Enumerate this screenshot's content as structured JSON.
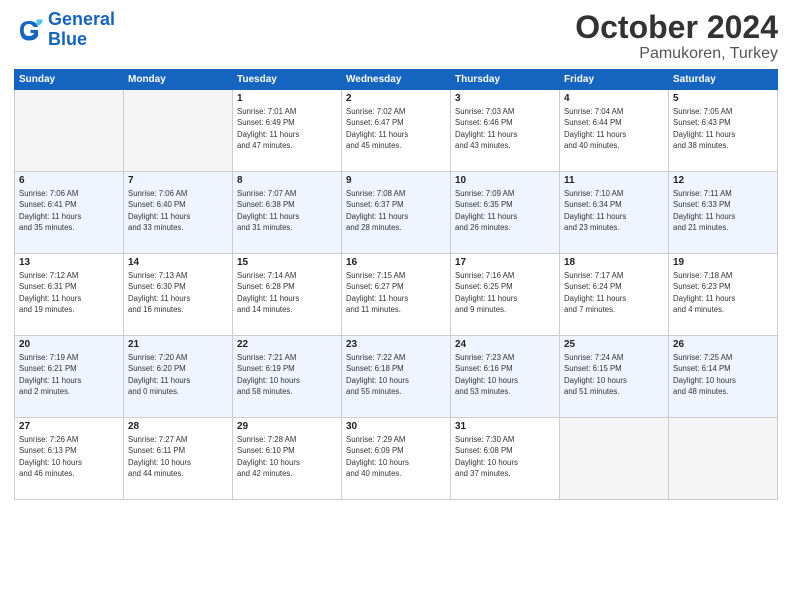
{
  "header": {
    "logo_line1": "General",
    "logo_line2": "Blue",
    "month": "October 2024",
    "location": "Pamukoren, Turkey"
  },
  "weekdays": [
    "Sunday",
    "Monday",
    "Tuesday",
    "Wednesday",
    "Thursday",
    "Friday",
    "Saturday"
  ],
  "weeks": [
    [
      {
        "day": "",
        "info": ""
      },
      {
        "day": "",
        "info": ""
      },
      {
        "day": "1",
        "info": "Sunrise: 7:01 AM\nSunset: 6:49 PM\nDaylight: 11 hours\nand 47 minutes."
      },
      {
        "day": "2",
        "info": "Sunrise: 7:02 AM\nSunset: 6:47 PM\nDaylight: 11 hours\nand 45 minutes."
      },
      {
        "day": "3",
        "info": "Sunrise: 7:03 AM\nSunset: 6:46 PM\nDaylight: 11 hours\nand 43 minutes."
      },
      {
        "day": "4",
        "info": "Sunrise: 7:04 AM\nSunset: 6:44 PM\nDaylight: 11 hours\nand 40 minutes."
      },
      {
        "day": "5",
        "info": "Sunrise: 7:05 AM\nSunset: 6:43 PM\nDaylight: 11 hours\nand 38 minutes."
      }
    ],
    [
      {
        "day": "6",
        "info": "Sunrise: 7:06 AM\nSunset: 6:41 PM\nDaylight: 11 hours\nand 35 minutes."
      },
      {
        "day": "7",
        "info": "Sunrise: 7:06 AM\nSunset: 6:40 PM\nDaylight: 11 hours\nand 33 minutes."
      },
      {
        "day": "8",
        "info": "Sunrise: 7:07 AM\nSunset: 6:38 PM\nDaylight: 11 hours\nand 31 minutes."
      },
      {
        "day": "9",
        "info": "Sunrise: 7:08 AM\nSunset: 6:37 PM\nDaylight: 11 hours\nand 28 minutes."
      },
      {
        "day": "10",
        "info": "Sunrise: 7:09 AM\nSunset: 6:35 PM\nDaylight: 11 hours\nand 26 minutes."
      },
      {
        "day": "11",
        "info": "Sunrise: 7:10 AM\nSunset: 6:34 PM\nDaylight: 11 hours\nand 23 minutes."
      },
      {
        "day": "12",
        "info": "Sunrise: 7:11 AM\nSunset: 6:33 PM\nDaylight: 11 hours\nand 21 minutes."
      }
    ],
    [
      {
        "day": "13",
        "info": "Sunrise: 7:12 AM\nSunset: 6:31 PM\nDaylight: 11 hours\nand 19 minutes."
      },
      {
        "day": "14",
        "info": "Sunrise: 7:13 AM\nSunset: 6:30 PM\nDaylight: 11 hours\nand 16 minutes."
      },
      {
        "day": "15",
        "info": "Sunrise: 7:14 AM\nSunset: 6:28 PM\nDaylight: 11 hours\nand 14 minutes."
      },
      {
        "day": "16",
        "info": "Sunrise: 7:15 AM\nSunset: 6:27 PM\nDaylight: 11 hours\nand 11 minutes."
      },
      {
        "day": "17",
        "info": "Sunrise: 7:16 AM\nSunset: 6:25 PM\nDaylight: 11 hours\nand 9 minutes."
      },
      {
        "day": "18",
        "info": "Sunrise: 7:17 AM\nSunset: 6:24 PM\nDaylight: 11 hours\nand 7 minutes."
      },
      {
        "day": "19",
        "info": "Sunrise: 7:18 AM\nSunset: 6:23 PM\nDaylight: 11 hours\nand 4 minutes."
      }
    ],
    [
      {
        "day": "20",
        "info": "Sunrise: 7:19 AM\nSunset: 6:21 PM\nDaylight: 11 hours\nand 2 minutes."
      },
      {
        "day": "21",
        "info": "Sunrise: 7:20 AM\nSunset: 6:20 PM\nDaylight: 11 hours\nand 0 minutes."
      },
      {
        "day": "22",
        "info": "Sunrise: 7:21 AM\nSunset: 6:19 PM\nDaylight: 10 hours\nand 58 minutes."
      },
      {
        "day": "23",
        "info": "Sunrise: 7:22 AM\nSunset: 6:18 PM\nDaylight: 10 hours\nand 55 minutes."
      },
      {
        "day": "24",
        "info": "Sunrise: 7:23 AM\nSunset: 6:16 PM\nDaylight: 10 hours\nand 53 minutes."
      },
      {
        "day": "25",
        "info": "Sunrise: 7:24 AM\nSunset: 6:15 PM\nDaylight: 10 hours\nand 51 minutes."
      },
      {
        "day": "26",
        "info": "Sunrise: 7:25 AM\nSunset: 6:14 PM\nDaylight: 10 hours\nand 48 minutes."
      }
    ],
    [
      {
        "day": "27",
        "info": "Sunrise: 7:26 AM\nSunset: 6:13 PM\nDaylight: 10 hours\nand 46 minutes."
      },
      {
        "day": "28",
        "info": "Sunrise: 7:27 AM\nSunset: 6:11 PM\nDaylight: 10 hours\nand 44 minutes."
      },
      {
        "day": "29",
        "info": "Sunrise: 7:28 AM\nSunset: 6:10 PM\nDaylight: 10 hours\nand 42 minutes."
      },
      {
        "day": "30",
        "info": "Sunrise: 7:29 AM\nSunset: 6:09 PM\nDaylight: 10 hours\nand 40 minutes."
      },
      {
        "day": "31",
        "info": "Sunrise: 7:30 AM\nSunset: 6:08 PM\nDaylight: 10 hours\nand 37 minutes."
      },
      {
        "day": "",
        "info": ""
      },
      {
        "day": "",
        "info": ""
      }
    ]
  ]
}
